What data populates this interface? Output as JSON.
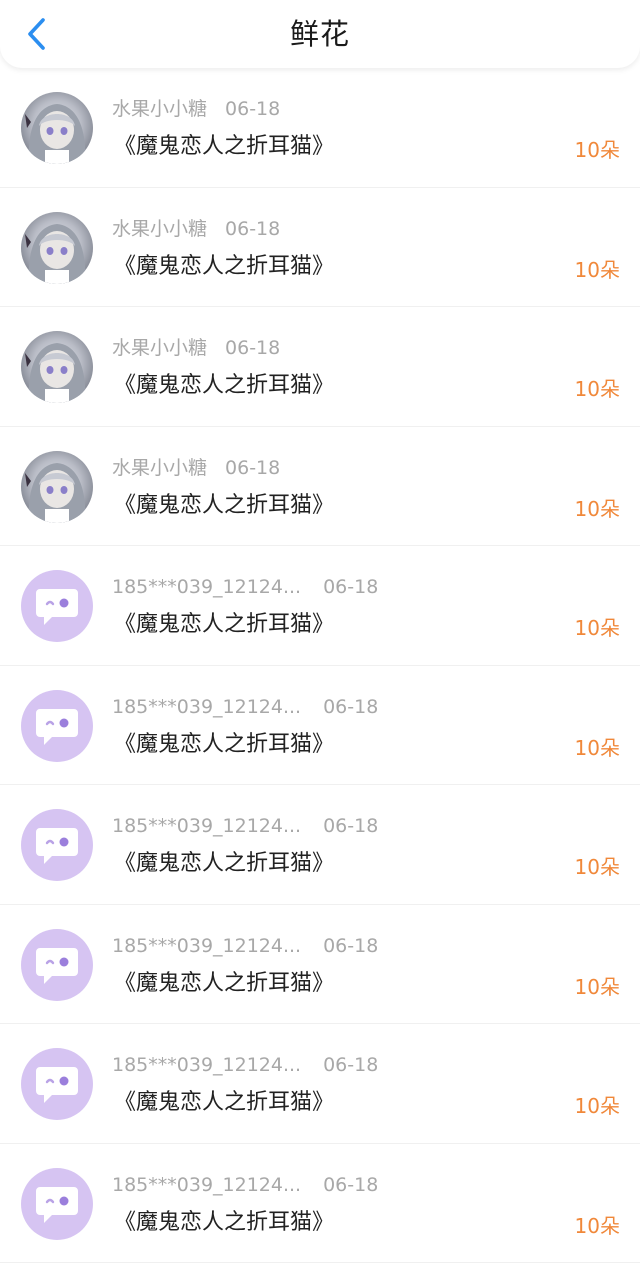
{
  "header": {
    "title": "鲜花"
  },
  "colors": {
    "accent_back": "#2b8ef0",
    "count_orange": "#f0883a",
    "default_avatar_bg": "#d6c4f2"
  },
  "records": [
    {
      "user": "水果小小糖",
      "date": "06-18",
      "book": "《魔鬼恋人之折耳猫》",
      "count": "10朵",
      "avatar": "anime"
    },
    {
      "user": "水果小小糖",
      "date": "06-18",
      "book": "《魔鬼恋人之折耳猫》",
      "count": "10朵",
      "avatar": "anime"
    },
    {
      "user": "水果小小糖",
      "date": "06-18",
      "book": "《魔鬼恋人之折耳猫》",
      "count": "10朵",
      "avatar": "anime"
    },
    {
      "user": "水果小小糖",
      "date": "06-18",
      "book": "《魔鬼恋人之折耳猫》",
      "count": "10朵",
      "avatar": "anime"
    },
    {
      "user": "185***039_12124...",
      "date": "06-18",
      "book": "《魔鬼恋人之折耳猫》",
      "count": "10朵",
      "avatar": "default"
    },
    {
      "user": "185***039_12124...",
      "date": "06-18",
      "book": "《魔鬼恋人之折耳猫》",
      "count": "10朵",
      "avatar": "default"
    },
    {
      "user": "185***039_12124...",
      "date": "06-18",
      "book": "《魔鬼恋人之折耳猫》",
      "count": "10朵",
      "avatar": "default"
    },
    {
      "user": "185***039_12124...",
      "date": "06-18",
      "book": "《魔鬼恋人之折耳猫》",
      "count": "10朵",
      "avatar": "default"
    },
    {
      "user": "185***039_12124...",
      "date": "06-18",
      "book": "《魔鬼恋人之折耳猫》",
      "count": "10朵",
      "avatar": "default"
    },
    {
      "user": "185***039_12124...",
      "date": "06-18",
      "book": "《魔鬼恋人之折耳猫》",
      "count": "10朵",
      "avatar": "default"
    }
  ]
}
